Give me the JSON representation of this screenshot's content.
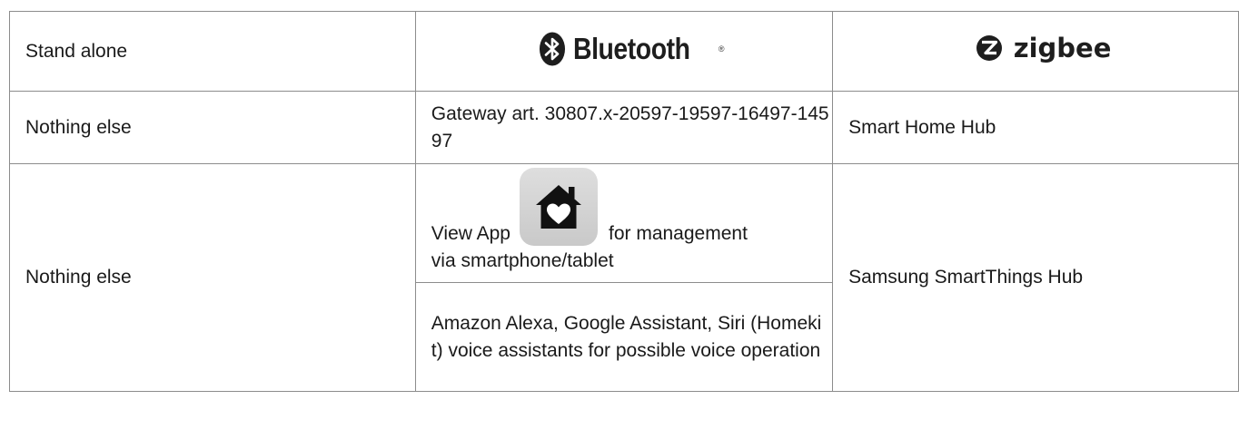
{
  "table": {
    "header": {
      "standalone": "Stand alone",
      "bluetooth_logo_text": "Bluetooth",
      "bluetooth_reg_mark": "®",
      "zigbee_logo_text": "zigbee"
    },
    "row_gateway": {
      "col1": "Nothing else",
      "col2": "Gateway art. 30807.x-20597-19597-16497-14597",
      "col3": "Smart Home Hub"
    },
    "row_app": {
      "col1": "Nothing else",
      "col2_before_icon": "View App",
      "col2_after_icon": "for management",
      "col2_line2": "via smartphone/tablet",
      "col2_voice": "Amazon Alexa, Google Assistant, Siri (Homekit) voice assistants for possible voice operation",
      "col3": "Samsung SmartThings Hub",
      "app_icon": "home-heart-icon"
    }
  },
  "colors": {
    "border": "#8c8c8c",
    "text": "#1a1a1a",
    "icon_bg": "#d3d3d3"
  }
}
